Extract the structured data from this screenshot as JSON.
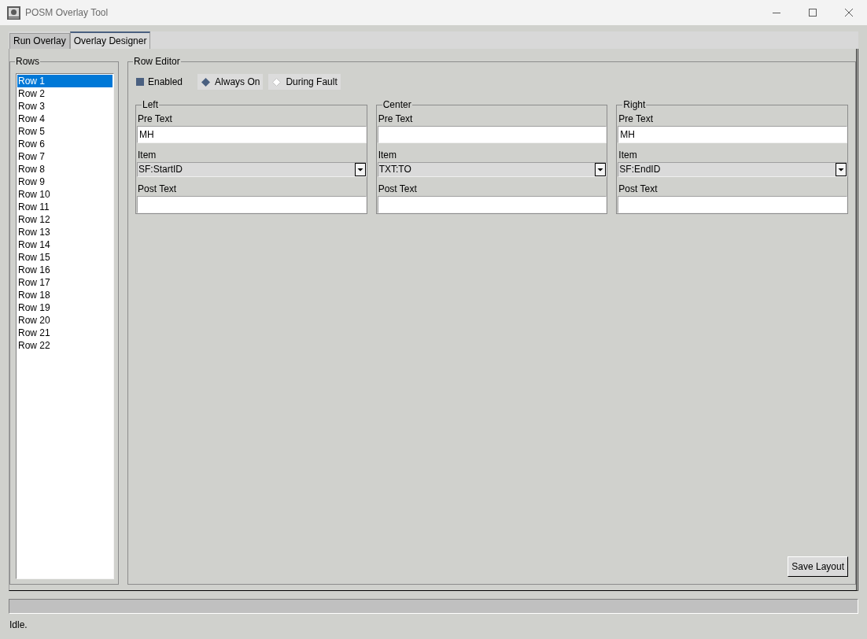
{
  "window": {
    "title": "POSM Overlay Tool"
  },
  "tabs": [
    {
      "label": "Run Overlay",
      "selected": false
    },
    {
      "label": "Overlay Designer",
      "selected": true
    }
  ],
  "rows_panel": {
    "title": "Rows",
    "items": [
      {
        "label": "Row 1",
        "selected": true
      },
      {
        "label": "Row 2",
        "selected": false
      },
      {
        "label": "Row 3",
        "selected": false
      },
      {
        "label": "Row 4",
        "selected": false
      },
      {
        "label": "Row 5",
        "selected": false
      },
      {
        "label": "Row 6",
        "selected": false
      },
      {
        "label": "Row 7",
        "selected": false
      },
      {
        "label": "Row 8",
        "selected": false
      },
      {
        "label": "Row 9",
        "selected": false
      },
      {
        "label": "Row 10",
        "selected": false
      },
      {
        "label": "Row 11",
        "selected": false
      },
      {
        "label": "Row 12",
        "selected": false
      },
      {
        "label": "Row 13",
        "selected": false
      },
      {
        "label": "Row 14",
        "selected": false
      },
      {
        "label": "Row 15",
        "selected": false
      },
      {
        "label": "Row 16",
        "selected": false
      },
      {
        "label": "Row 17",
        "selected": false
      },
      {
        "label": "Row 18",
        "selected": false
      },
      {
        "label": "Row 19",
        "selected": false
      },
      {
        "label": "Row 20",
        "selected": false
      },
      {
        "label": "Row 21",
        "selected": false
      },
      {
        "label": "Row 22",
        "selected": false
      }
    ]
  },
  "row_editor": {
    "title": "Row Editor",
    "enabled": {
      "label": "Enabled",
      "checked": true
    },
    "modes": [
      {
        "label": "Always On",
        "selected": true
      },
      {
        "label": "During Fault",
        "selected": false
      }
    ],
    "columns": [
      {
        "title": "Left",
        "fields": [
          {
            "kind": "text",
            "label": "Pre Text",
            "value": "MH"
          },
          {
            "kind": "dropdown",
            "label": "Item",
            "value": "SF:StartID"
          },
          {
            "kind": "text",
            "label": "Post Text"
          }
        ]
      },
      {
        "title": "Center",
        "fields": [
          {
            "kind": "text",
            "label": "Pre Text"
          },
          {
            "kind": "dropdown",
            "label": "Item",
            "value": "TXT:TO"
          },
          {
            "kind": "text",
            "label": "Post Text"
          }
        ]
      },
      {
        "title": "Right",
        "fields": [
          {
            "kind": "text",
            "label": "Pre Text",
            "value": "MH"
          },
          {
            "kind": "dropdown",
            "label": "Item",
            "value": "SF:EndID"
          },
          {
            "kind": "text",
            "label": "Post Text"
          }
        ]
      }
    ],
    "save_button": "Save Layout"
  },
  "progress": {
    "level": 0
  },
  "status_bar": {
    "text": "Idle."
  }
}
